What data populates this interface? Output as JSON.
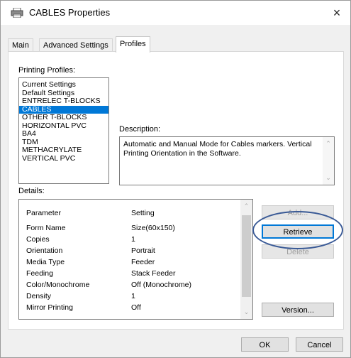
{
  "window": {
    "title": "CABLES Properties",
    "close_label": "×"
  },
  "tabs": [
    {
      "label": "Main",
      "active": false
    },
    {
      "label": "Advanced Settings",
      "active": false
    },
    {
      "label": "Profiles",
      "active": true
    }
  ],
  "profiles": {
    "label": "Printing Profiles:",
    "items": [
      "Current Settings",
      "Default Settings",
      "ENTRELEC T-BLOCKS",
      "CABLES",
      "OTHER T-BLOCKS",
      "HORIZONTAL PVC",
      "BA4",
      "TDM",
      "METHACRYLATE",
      "VERTICAL PVC"
    ],
    "selected": "CABLES"
  },
  "description": {
    "label": "Description:",
    "text": "Automatic and Manual Mode for Cables markers. Vertical Printing Orientation in the Software."
  },
  "details": {
    "label": "Details:",
    "headers": [
      "Parameter",
      "Setting"
    ],
    "rows": [
      [
        "Form Name",
        "Size(60x150)"
      ],
      [
        "Copies",
        "1"
      ],
      [
        "Orientation",
        "Portrait"
      ],
      [
        "Media Type",
        "Feeder"
      ],
      [
        "Feeding",
        "Stack Feeder"
      ],
      [
        "Color/Monochrome",
        "Off (Monochrome)"
      ],
      [
        "Density",
        "1"
      ],
      [
        "Mirror Printing",
        "Off"
      ]
    ]
  },
  "buttons": {
    "add": "Add...",
    "retrieve": "Retrieve",
    "delete": "Delete",
    "version": "Version...",
    "ok": "OK",
    "cancel": "Cancel"
  },
  "colors": {
    "selection": "#0078d7",
    "annotation_ellipse": "#3a5a96"
  }
}
